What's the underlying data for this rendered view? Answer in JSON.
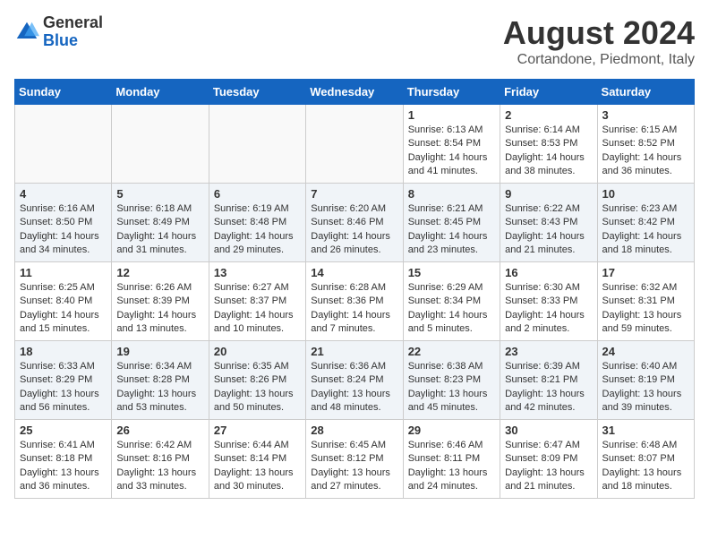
{
  "header": {
    "logo_line1": "General",
    "logo_line2": "Blue",
    "month_year": "August 2024",
    "location": "Cortandone, Piedmont, Italy"
  },
  "days_of_week": [
    "Sunday",
    "Monday",
    "Tuesday",
    "Wednesday",
    "Thursday",
    "Friday",
    "Saturday"
  ],
  "weeks": [
    [
      {
        "day": "",
        "info": ""
      },
      {
        "day": "",
        "info": ""
      },
      {
        "day": "",
        "info": ""
      },
      {
        "day": "",
        "info": ""
      },
      {
        "day": "1",
        "info": "Sunrise: 6:13 AM\nSunset: 8:54 PM\nDaylight: 14 hours\nand 41 minutes."
      },
      {
        "day": "2",
        "info": "Sunrise: 6:14 AM\nSunset: 8:53 PM\nDaylight: 14 hours\nand 38 minutes."
      },
      {
        "day": "3",
        "info": "Sunrise: 6:15 AM\nSunset: 8:52 PM\nDaylight: 14 hours\nand 36 minutes."
      }
    ],
    [
      {
        "day": "4",
        "info": "Sunrise: 6:16 AM\nSunset: 8:50 PM\nDaylight: 14 hours\nand 34 minutes."
      },
      {
        "day": "5",
        "info": "Sunrise: 6:18 AM\nSunset: 8:49 PM\nDaylight: 14 hours\nand 31 minutes."
      },
      {
        "day": "6",
        "info": "Sunrise: 6:19 AM\nSunset: 8:48 PM\nDaylight: 14 hours\nand 29 minutes."
      },
      {
        "day": "7",
        "info": "Sunrise: 6:20 AM\nSunset: 8:46 PM\nDaylight: 14 hours\nand 26 minutes."
      },
      {
        "day": "8",
        "info": "Sunrise: 6:21 AM\nSunset: 8:45 PM\nDaylight: 14 hours\nand 23 minutes."
      },
      {
        "day": "9",
        "info": "Sunrise: 6:22 AM\nSunset: 8:43 PM\nDaylight: 14 hours\nand 21 minutes."
      },
      {
        "day": "10",
        "info": "Sunrise: 6:23 AM\nSunset: 8:42 PM\nDaylight: 14 hours\nand 18 minutes."
      }
    ],
    [
      {
        "day": "11",
        "info": "Sunrise: 6:25 AM\nSunset: 8:40 PM\nDaylight: 14 hours\nand 15 minutes."
      },
      {
        "day": "12",
        "info": "Sunrise: 6:26 AM\nSunset: 8:39 PM\nDaylight: 14 hours\nand 13 minutes."
      },
      {
        "day": "13",
        "info": "Sunrise: 6:27 AM\nSunset: 8:37 PM\nDaylight: 14 hours\nand 10 minutes."
      },
      {
        "day": "14",
        "info": "Sunrise: 6:28 AM\nSunset: 8:36 PM\nDaylight: 14 hours\nand 7 minutes."
      },
      {
        "day": "15",
        "info": "Sunrise: 6:29 AM\nSunset: 8:34 PM\nDaylight: 14 hours\nand 5 minutes."
      },
      {
        "day": "16",
        "info": "Sunrise: 6:30 AM\nSunset: 8:33 PM\nDaylight: 14 hours\nand 2 minutes."
      },
      {
        "day": "17",
        "info": "Sunrise: 6:32 AM\nSunset: 8:31 PM\nDaylight: 13 hours\nand 59 minutes."
      }
    ],
    [
      {
        "day": "18",
        "info": "Sunrise: 6:33 AM\nSunset: 8:29 PM\nDaylight: 13 hours\nand 56 minutes."
      },
      {
        "day": "19",
        "info": "Sunrise: 6:34 AM\nSunset: 8:28 PM\nDaylight: 13 hours\nand 53 minutes."
      },
      {
        "day": "20",
        "info": "Sunrise: 6:35 AM\nSunset: 8:26 PM\nDaylight: 13 hours\nand 50 minutes."
      },
      {
        "day": "21",
        "info": "Sunrise: 6:36 AM\nSunset: 8:24 PM\nDaylight: 13 hours\nand 48 minutes."
      },
      {
        "day": "22",
        "info": "Sunrise: 6:38 AM\nSunset: 8:23 PM\nDaylight: 13 hours\nand 45 minutes."
      },
      {
        "day": "23",
        "info": "Sunrise: 6:39 AM\nSunset: 8:21 PM\nDaylight: 13 hours\nand 42 minutes."
      },
      {
        "day": "24",
        "info": "Sunrise: 6:40 AM\nSunset: 8:19 PM\nDaylight: 13 hours\nand 39 minutes."
      }
    ],
    [
      {
        "day": "25",
        "info": "Sunrise: 6:41 AM\nSunset: 8:18 PM\nDaylight: 13 hours\nand 36 minutes."
      },
      {
        "day": "26",
        "info": "Sunrise: 6:42 AM\nSunset: 8:16 PM\nDaylight: 13 hours\nand 33 minutes."
      },
      {
        "day": "27",
        "info": "Sunrise: 6:44 AM\nSunset: 8:14 PM\nDaylight: 13 hours\nand 30 minutes."
      },
      {
        "day": "28",
        "info": "Sunrise: 6:45 AM\nSunset: 8:12 PM\nDaylight: 13 hours\nand 27 minutes."
      },
      {
        "day": "29",
        "info": "Sunrise: 6:46 AM\nSunset: 8:11 PM\nDaylight: 13 hours\nand 24 minutes."
      },
      {
        "day": "30",
        "info": "Sunrise: 6:47 AM\nSunset: 8:09 PM\nDaylight: 13 hours\nand 21 minutes."
      },
      {
        "day": "31",
        "info": "Sunrise: 6:48 AM\nSunset: 8:07 PM\nDaylight: 13 hours\nand 18 minutes."
      }
    ]
  ]
}
